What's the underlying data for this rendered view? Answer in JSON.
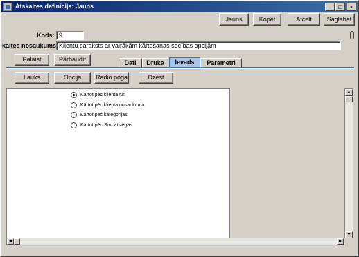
{
  "window": {
    "title": "Atskaites definīcija: Jauns",
    "minimize": "_",
    "maximize": "□",
    "close": "×"
  },
  "toolbar": {
    "new_label": "Jauns",
    "copy_label": "Kopēt",
    "cancel_label": "Atcelt",
    "save_label": "Saglabāt"
  },
  "form": {
    "code_label": "Kods:",
    "code_value": "9",
    "name_label": "kaites nosaukums:",
    "name_value": "Klientu saraksts ar vairākām kārtošanas secības opcijām"
  },
  "actions": {
    "run_label": "Palaist",
    "verify_label": "Pārbaudīt"
  },
  "tabs": [
    {
      "label": "Dati"
    },
    {
      "label": "Druka"
    },
    {
      "label": "Ievads"
    },
    {
      "label": "Parametri"
    }
  ],
  "active_tab": "Ievads",
  "input_toolbar": {
    "field_label": "Lauks",
    "option_label": "Opcija",
    "radio_label": "Radio poga",
    "delete_label": "Dzēst"
  },
  "radio_options": [
    {
      "label": "Kārtot pēc klienta Nr.",
      "checked": true
    },
    {
      "label": "Kārtot pēc klienta nosaukuma",
      "checked": false
    },
    {
      "label": "Kārtot pēc kategorijas",
      "checked": false
    },
    {
      "label": "Kārtot pēc Sort atslēgas",
      "checked": false
    }
  ],
  "scroll": {
    "up": "▲",
    "down": "▼",
    "left": "◄",
    "right": "►"
  }
}
